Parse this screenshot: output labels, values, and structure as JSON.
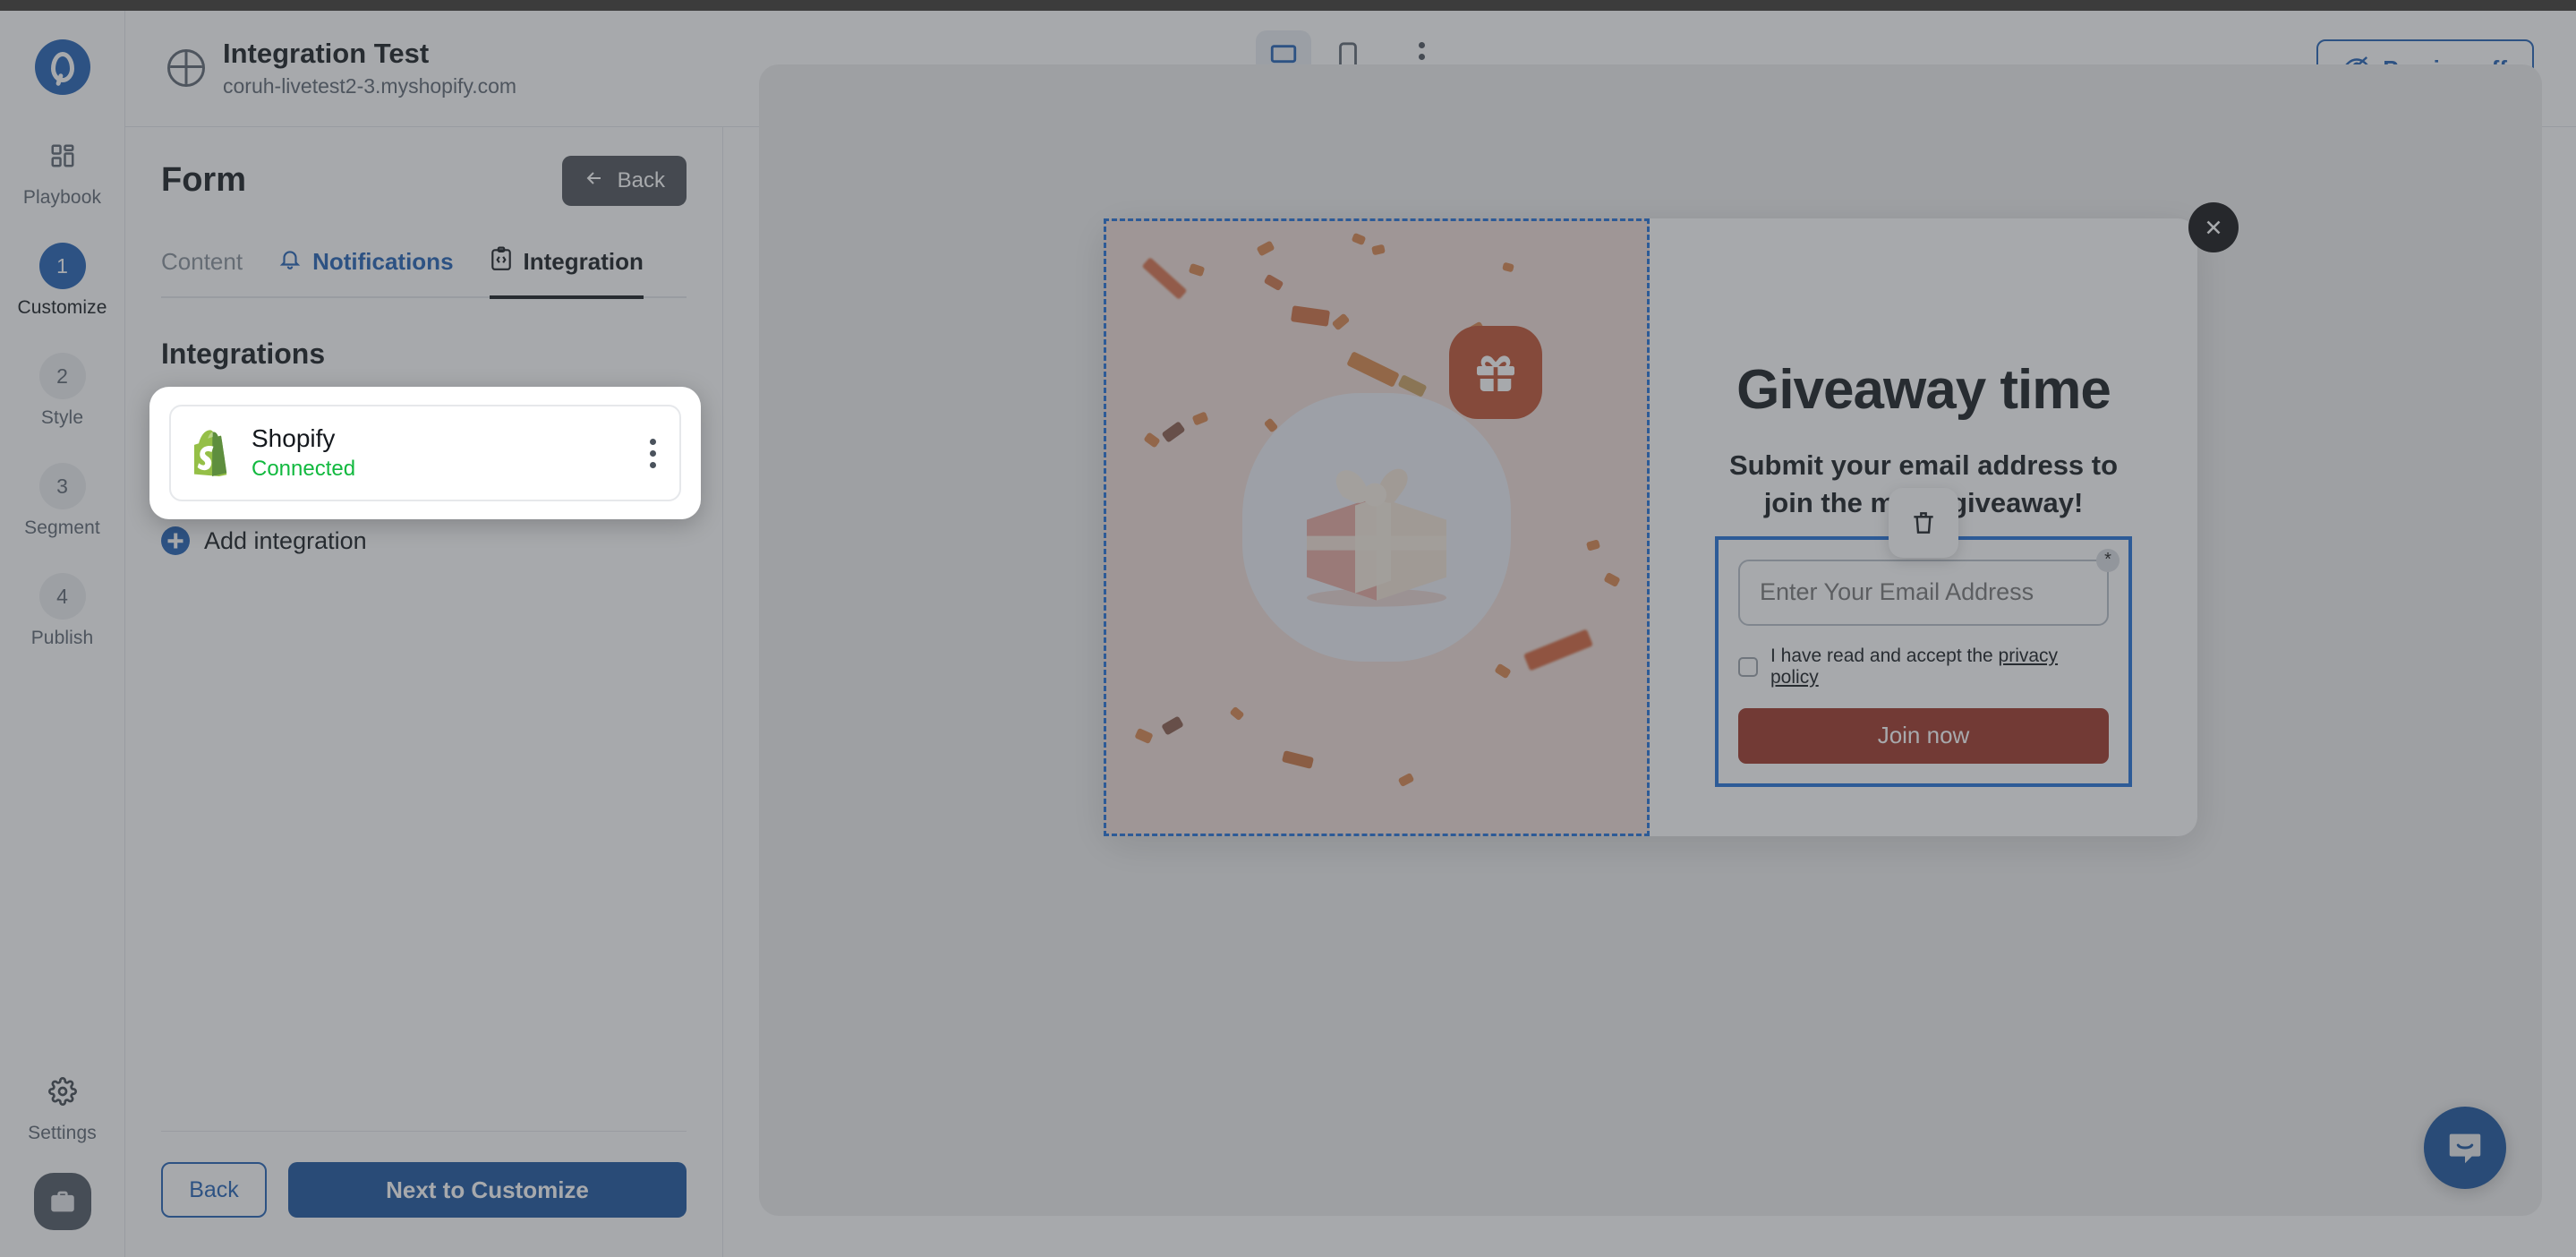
{
  "topbar": {
    "site_title": "Integration Test",
    "site_domain": "coruh-livetest2-3.myshopify.com",
    "preview_label": "Preview off",
    "device_desktop": "desktop-view",
    "device_mobile": "mobile-view",
    "accent_blue": "#1e5fb4",
    "status_dot_color": "#138a36"
  },
  "sidebar": {
    "items": [
      {
        "badge": "",
        "label": "Playbook",
        "icon": "grid-icon",
        "active": false
      },
      {
        "badge": "1",
        "label": "Customize",
        "icon": "",
        "active": true
      },
      {
        "badge": "2",
        "label": "Style",
        "icon": "",
        "active": false
      },
      {
        "badge": "3",
        "label": "Segment",
        "icon": "",
        "active": false
      },
      {
        "badge": "4",
        "label": "Publish",
        "icon": "",
        "active": false
      }
    ],
    "settings_label": "Settings",
    "settings_icon": "gear-icon",
    "avatar_icon": "briefcase-icon"
  },
  "panel": {
    "title": "Form",
    "back_top_label": "Back",
    "tabs": [
      {
        "label": "Content",
        "icon": "",
        "state": "inactive"
      },
      {
        "label": "Notifications",
        "icon": "bell-icon",
        "state": "blue"
      },
      {
        "label": "Integration",
        "icon": "code-clipboard-icon",
        "state": "active"
      }
    ],
    "section_title": "Integrations",
    "integrations": [
      {
        "name": "Shopify",
        "status": "Connected",
        "status_color": "#12b93f",
        "logo": "shopify-logo"
      }
    ],
    "add_integration_label": "Add integration",
    "footer": {
      "back_label": "Back",
      "next_label": "Next to Customize"
    }
  },
  "preview": {
    "heading": "Giveaway time",
    "subtitle": "Submit your email address to join the mega giveaway!",
    "email_placeholder": "Enter Your Email Address",
    "email_value": "",
    "required_marker": "*",
    "consent_prefix": "I have read and accept the ",
    "consent_link": "privacy policy",
    "submit_label": "Join now",
    "submit_color": "#9e3324",
    "close_icon": "close-icon",
    "delete_icon": "trash-icon",
    "image_badge_icon": "gift-icon",
    "selection_color": "#1f6fd8"
  },
  "chat": {
    "icon": "chat-bubble-icon",
    "color": "#17529e"
  }
}
